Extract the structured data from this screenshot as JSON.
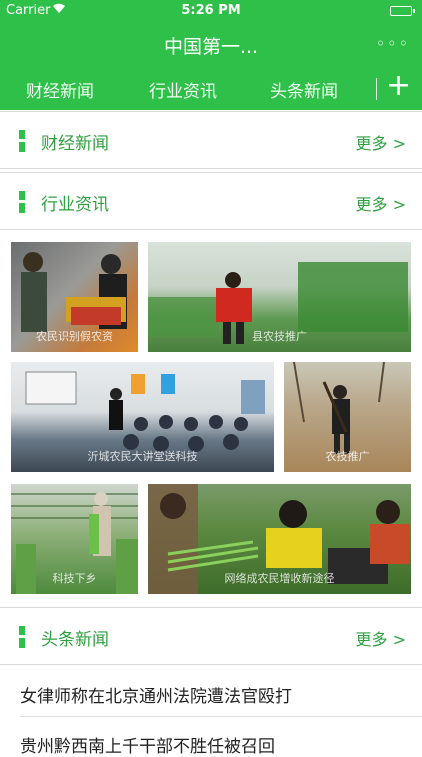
{
  "status_bar": {
    "carrier": "Carrier",
    "time": "5:26 PM",
    "wifi_icon": "wifi-icon",
    "battery_icon": "battery-icon"
  },
  "nav": {
    "title": "中国第一...",
    "menu_icon": "more-dots-icon",
    "menu_symbol": "◦◦◦"
  },
  "tabs": [
    {
      "label": "财经新闻"
    },
    {
      "label": "行业资讯"
    },
    {
      "label": "头条新闻"
    }
  ],
  "tab_add_symbol": "+",
  "sections": {
    "finance": {
      "label": "财经新闻",
      "more": "更多 >"
    },
    "industry": {
      "label": "行业资讯",
      "more": "更多 >"
    },
    "headlines": {
      "label": "头条新闻",
      "more": "更多 >"
    }
  },
  "photos": [
    {
      "caption": "农民识别假农资"
    },
    {
      "caption": "县农技推广"
    },
    {
      "caption": "沂城农民大讲堂送科技"
    },
    {
      "caption": "农技推广"
    },
    {
      "caption": "科技下乡"
    },
    {
      "caption": "网络成农民增收新途径"
    }
  ],
  "news": [
    {
      "title": "女律师称在北京通州法院遭法官殴打"
    },
    {
      "title": "贵州黔西南上千干部不胜任被召回"
    }
  ],
  "colors": {
    "brand_green": "#2fc04a",
    "accent_text": "#2fa040"
  }
}
